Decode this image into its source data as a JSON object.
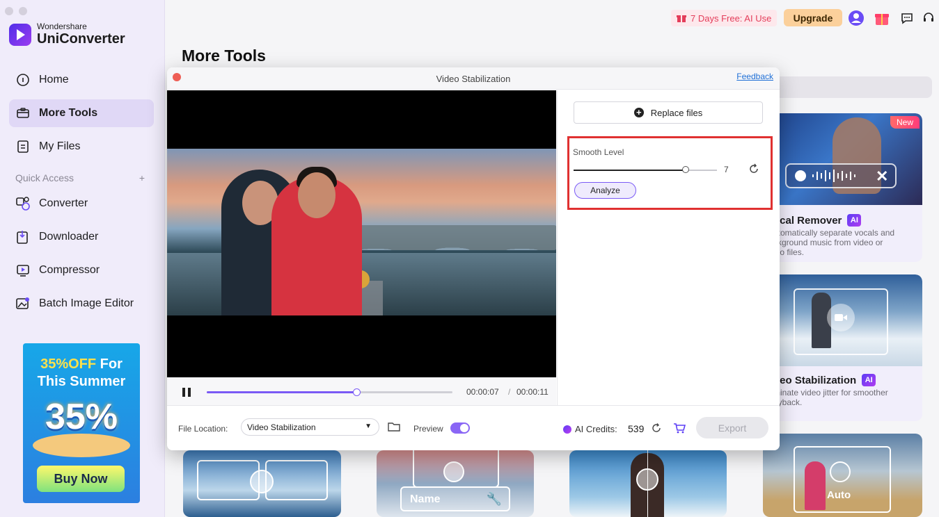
{
  "brand": {
    "line1": "Wondershare",
    "line2": "UniConverter"
  },
  "nav": {
    "items": [
      {
        "label": "Home",
        "icon": "home-icon"
      },
      {
        "label": "More Tools",
        "icon": "toolbox-icon",
        "active": true
      },
      {
        "label": "My Files",
        "icon": "file-icon"
      }
    ],
    "quick_access_label": "Quick Access",
    "quick_access_add": "+",
    "quick_items": [
      {
        "label": "Converter",
        "icon": "converter-icon"
      },
      {
        "label": "Downloader",
        "icon": "downloader-icon"
      },
      {
        "label": "Compressor",
        "icon": "compressor-icon"
      },
      {
        "label": "Batch Image Editor",
        "icon": "image-editor-icon"
      }
    ]
  },
  "promo": {
    "title_a": "35%OFF",
    "title_b": " For",
    "title_c": "This Summer",
    "big": "35%",
    "button": "Buy Now"
  },
  "topbar": {
    "trial": "7 Days Free: AI Use",
    "upgrade": "Upgrade"
  },
  "page_title": "More Tools",
  "cards": {
    "vocal": {
      "name": "ocal Remover",
      "badge": "AI",
      "new": "New",
      "desc1": "utomatically separate vocals and",
      "desc2": "ckground music from video or",
      "desc3": "dio files."
    },
    "stab": {
      "name": "deo Stabilization",
      "badge": "AI",
      "desc1": "minate video jitter for smoother",
      "desc2": "ayback."
    },
    "bottom": {
      "name_label": "Name",
      "auto_label": "Auto"
    }
  },
  "modal": {
    "title": "Video Stabilization",
    "feedback": "Feedback",
    "replace": "Replace files",
    "smooth_label": "Smooth Level",
    "smooth_value": "7",
    "smooth_fraction": 0.78,
    "analyze": "Analyze",
    "progress_fraction": 0.61,
    "time_current": "00:00:07",
    "time_sep": "/",
    "time_total": "00:00:11",
    "file_location_label": "File Location:",
    "file_location_value": "Video Stabilization",
    "preview_label": "Preview",
    "credits_label": "AI Credits:",
    "credits_value": "539",
    "export": "Export"
  }
}
